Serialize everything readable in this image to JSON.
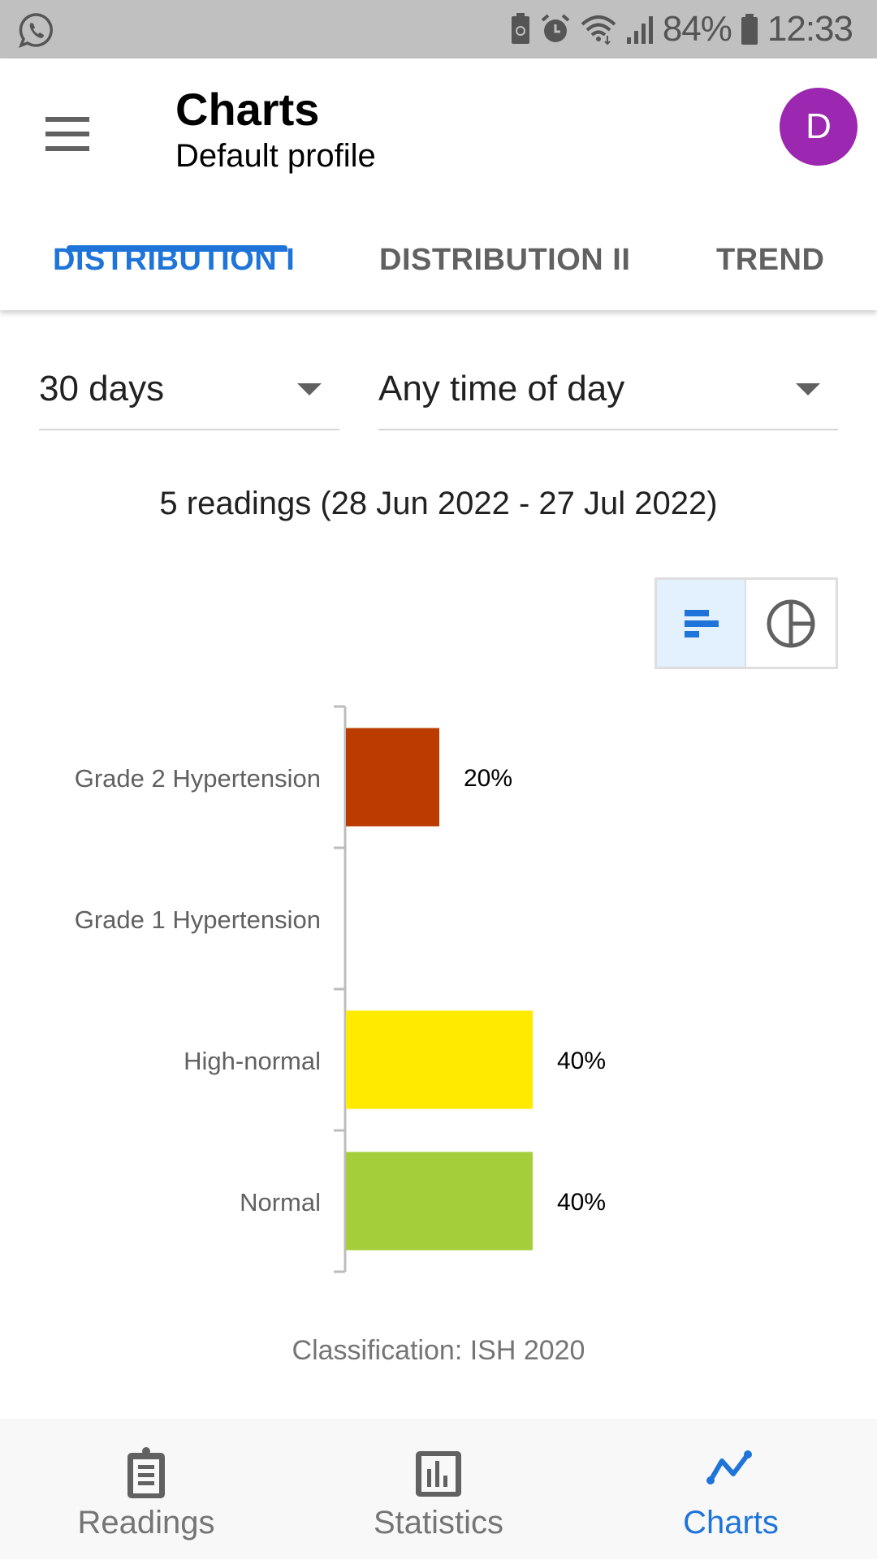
{
  "status_bar": {
    "battery_percent": "84%",
    "time": "12:33",
    "icons": [
      "whatsapp-icon",
      "battery-saver-icon",
      "alarm-icon",
      "wifi-icon",
      "signal-icon",
      "battery-icon"
    ]
  },
  "app_bar": {
    "title": "Charts",
    "subtitle": "Default profile",
    "avatar_letter": "D",
    "avatar_color": "#9c27b0"
  },
  "tabs": [
    {
      "label": "DISTRIBUTION I",
      "active": true
    },
    {
      "label": "DISTRIBUTION II",
      "active": false
    },
    {
      "label": "TREND",
      "active": false
    }
  ],
  "filters": {
    "period": "30 days",
    "time_of_day": "Any time of day"
  },
  "readings_info": "5 readings (28 Jun 2022 - 27 Jul 2022)",
  "view_toggle": {
    "options": [
      "bar-chart-view",
      "pie-chart-view"
    ],
    "selected": "bar-chart-view"
  },
  "chart_data": {
    "type": "bar",
    "orientation": "horizontal",
    "categories": [
      "Grade 2 Hypertension",
      "Grade 1 Hypertension",
      "High-normal",
      "Normal"
    ],
    "values": [
      20,
      0,
      40,
      40
    ],
    "value_labels": [
      "20%",
      "",
      "40%",
      "40%"
    ],
    "colors": [
      "#bb3b00",
      "#e8632a",
      "#ffea00",
      "#a5cf3a"
    ],
    "unit": "%",
    "xlim": [
      0,
      100
    ],
    "grid": false,
    "legend": "none",
    "title": "",
    "xlabel": "",
    "ylabel": ""
  },
  "classification": "Classification: ISH 2020",
  "bottom_nav": [
    {
      "label": "Readings",
      "icon": "clipboard-icon",
      "active": false
    },
    {
      "label": "Statistics",
      "icon": "bar-chart-icon",
      "active": false
    },
    {
      "label": "Charts",
      "icon": "line-chart-icon",
      "active": true
    }
  ],
  "accent_color": "#1e74d8"
}
